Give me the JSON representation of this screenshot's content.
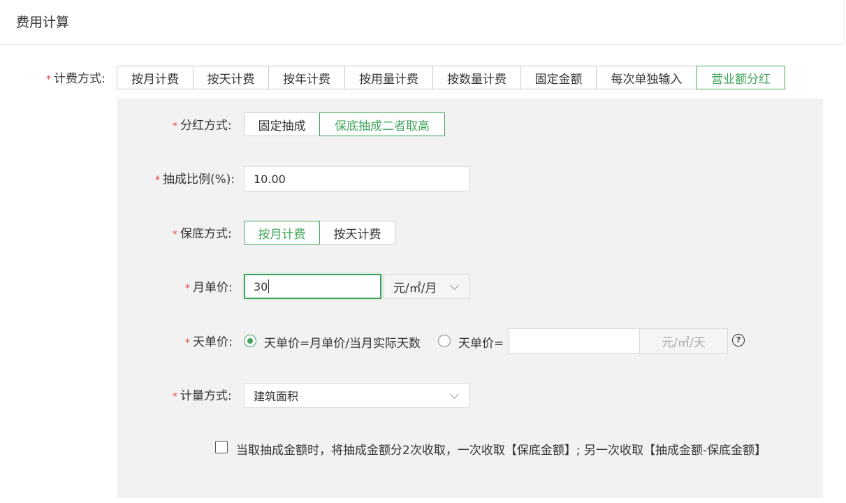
{
  "header": {
    "title": "费用计算"
  },
  "billing_method": {
    "label": "计费方式:",
    "options": [
      "按月计费",
      "按天计费",
      "按年计费",
      "按用量计费",
      "按数量计费",
      "固定金额",
      "每次单独输入",
      "营业额分红"
    ],
    "selected": "营业额分红"
  },
  "dividend_method": {
    "label": "分红方式:",
    "options": [
      "固定抽成",
      "保底抽成二者取高"
    ],
    "selected": "保底抽成二者取高"
  },
  "commission_ratio": {
    "label": "抽成比例(%):",
    "value": "10.00"
  },
  "guarantee_method": {
    "label": "保底方式:",
    "options": [
      "按月计费",
      "按天计费"
    ],
    "selected": "按月计费"
  },
  "monthly_price": {
    "label": "月单价:",
    "value": "30",
    "unit": "元/㎡/月"
  },
  "daily_price": {
    "label": "天单价:",
    "option_formula": "天单价=月单价/当月实际天数",
    "option_custom": "天单价=",
    "custom_value": "",
    "custom_unit": "元/㎡/天",
    "help": "?"
  },
  "measure_method": {
    "label": "计量方式:",
    "value": "建筑面积"
  },
  "split_option": {
    "text": "当取抽成金额时，将抽成金额分2次收取，一次收取【保底金额】; 另一次收取【抽成金额-保底金额】",
    "checked": false
  },
  "required_mark": "*",
  "colors": {
    "accent": "#3fa55b",
    "required": "#e64242",
    "panel_bg": "#f2f2f2"
  }
}
